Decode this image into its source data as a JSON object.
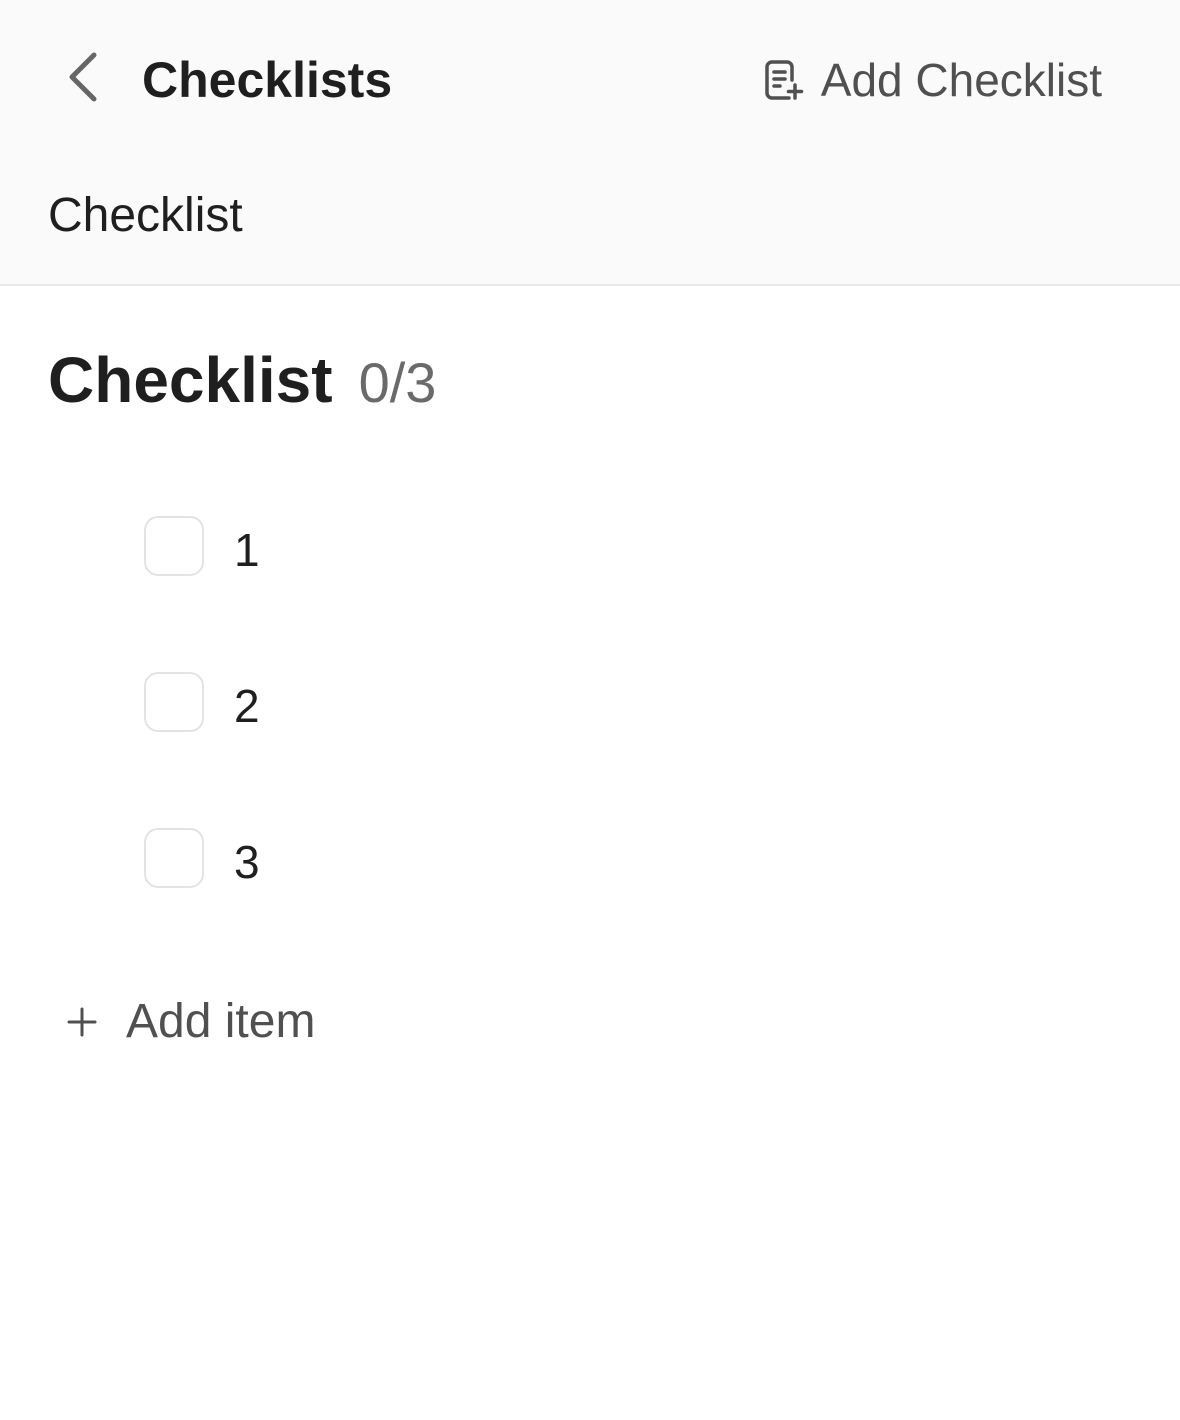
{
  "header": {
    "back_icon": "chevron-left-icon",
    "title": "Checklists",
    "add_checklist": {
      "icon": "document-plus-icon",
      "label": "Add Checklist"
    }
  },
  "section_tab": {
    "label": "Checklist"
  },
  "checklist": {
    "title": "Checklist",
    "progress": "0/3",
    "items": [
      {
        "label": "1",
        "checked": false
      },
      {
        "label": "2",
        "checked": false
      },
      {
        "label": "3",
        "checked": false
      }
    ]
  },
  "add_item": {
    "icon": "plus-icon",
    "label": "Add item"
  },
  "colors": {
    "header_background": "#fafafa",
    "text_primary": "#1f1f1f",
    "text_secondary": "#505050",
    "count_text": "#6a6a6a",
    "checkbox_border": "#e3e3e3"
  }
}
